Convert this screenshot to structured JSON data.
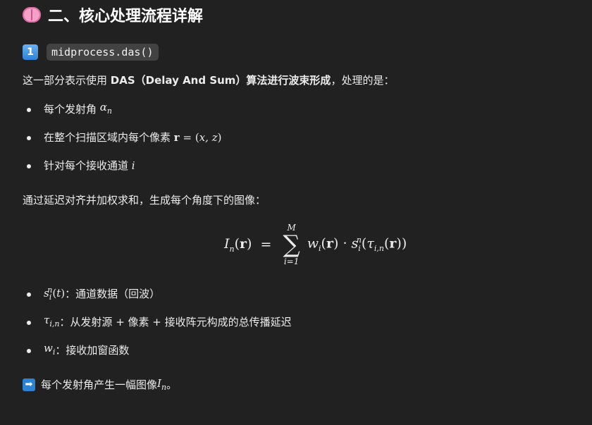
{
  "section": {
    "title": "二、核心处理流程详解",
    "icon": "brain-icon"
  },
  "subsection": {
    "number": "1",
    "code": "midprocess.das()"
  },
  "intro": {
    "prefix": "这一部分表示使用 ",
    "bold": "DAS（Delay And Sum）算法进行波束形成",
    "suffix": "，处理的是："
  },
  "bullets1": [
    {
      "text": "每个发射角 "
    },
    {
      "text": "在整个扫描区域内每个像素 "
    },
    {
      "text": "针对每个接收通道 "
    }
  ],
  "para2": "通过延迟对齐并加权求和，生成每个角度下的图像：",
  "formula": {
    "upper": "M",
    "lower": "i=1"
  },
  "bullets2": [
    {
      "text": "：通道数据（回波）"
    },
    {
      "text": "：从发射源 + 像素 + 接收阵元构成的总传播延迟"
    },
    {
      "text": "：接收加窗函数"
    }
  ],
  "conclusion": {
    "text": "每个发射角产生一幅图像 ",
    "end": "。",
    "icon": "right-arrow-icon"
  }
}
